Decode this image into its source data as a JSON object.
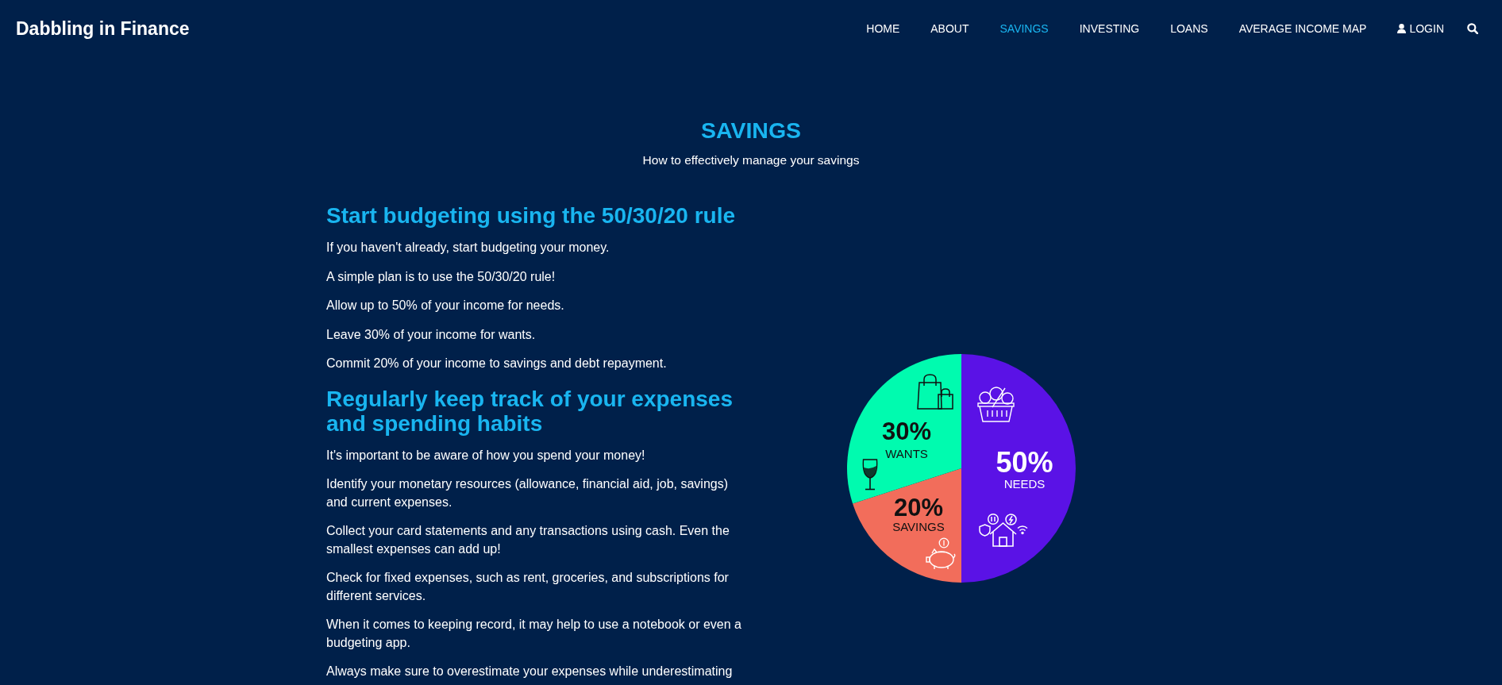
{
  "header": {
    "logo": "Dabbling in Finance",
    "nav": [
      {
        "label": "HOME",
        "selected": false
      },
      {
        "label": "ABOUT",
        "selected": false
      },
      {
        "label": "SAVINGS",
        "selected": true
      },
      {
        "label": "INVESTING",
        "selected": false
      },
      {
        "label": "LOANS",
        "selected": false
      },
      {
        "label": "AVERAGE INCOME MAP",
        "selected": false
      }
    ],
    "login": "LOGIN"
  },
  "page": {
    "title": "SAVINGS",
    "subtitle": "How to effectively manage your savings"
  },
  "sections": [
    {
      "heading": "Start budgeting using the 50/30/20 rule",
      "paragraphs": [
        "If you haven't already, start budgeting your money.",
        "A simple plan is to use the 50/30/20 rule!",
        "Allow up to 50% of your income for needs.",
        "Leave 30% of your income for wants.",
        "Commit 20% of your income to savings and debt repayment."
      ]
    },
    {
      "heading": "Regularly keep track of your expenses and spending habits",
      "paragraphs": [
        "It's important to be aware of how you spend your money!",
        "Identify your monetary resources (allowance, financial aid, job, savings) and current expenses.",
        "Collect your card statements and any transactions using cash. Even the smallest expenses can add up!",
        "Check for fixed expenses, such as rent, groceries, and subscriptions for different services.",
        "When it comes to keeping record, it may help to use a notebook or even a budgeting app.",
        "Always make sure to overestimate your expenses while underestimating"
      ]
    }
  ],
  "chart": {
    "chart_data": {
      "type": "pie",
      "categories": [
        "NEEDS",
        "SAVINGS",
        "WANTS"
      ],
      "values": [
        50,
        20,
        30
      ],
      "value_labels": [
        "50%",
        "20%",
        "30%"
      ]
    }
  }
}
